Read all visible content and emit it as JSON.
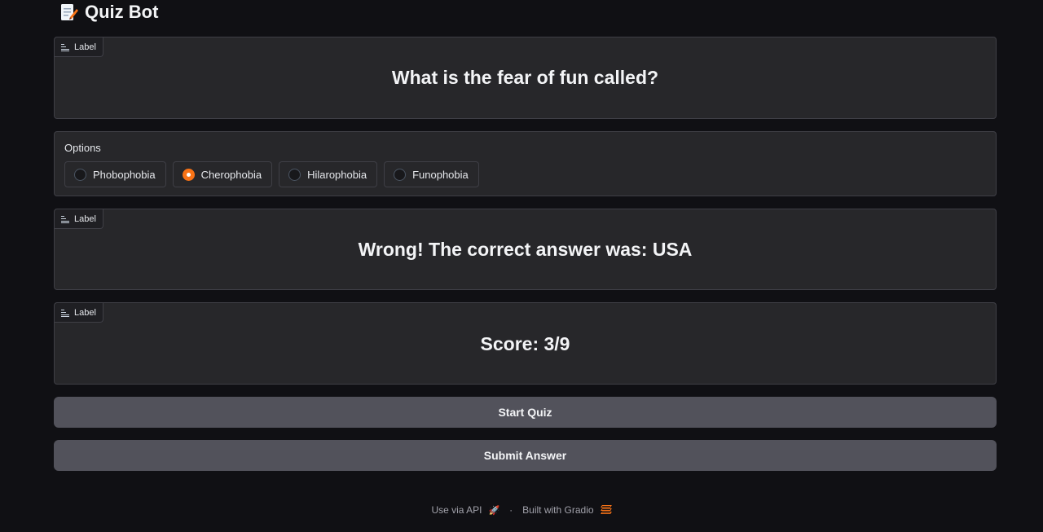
{
  "header": {
    "title": "Quiz Bot",
    "icon": "memo-icon"
  },
  "question": {
    "tag": "Label",
    "text": "What is the fear of fun called?"
  },
  "options": {
    "label": "Options",
    "items": [
      "Phobophobia",
      "Cherophobia",
      "Hilarophobia",
      "Funophobia"
    ],
    "selected": "Cherophobia"
  },
  "result": {
    "tag": "Label",
    "text": "Wrong! The correct answer was: USA"
  },
  "score": {
    "tag": "Label",
    "text": "Score: 3/9"
  },
  "buttons": {
    "start": "Start Quiz",
    "submit": "Submit Answer"
  },
  "footer": {
    "api": "Use via API",
    "sep": "·",
    "built": "Built with Gradio"
  },
  "colors": {
    "accent": "#f97316",
    "panel": "#27272a",
    "button": "#52525b",
    "background": "#101014"
  }
}
